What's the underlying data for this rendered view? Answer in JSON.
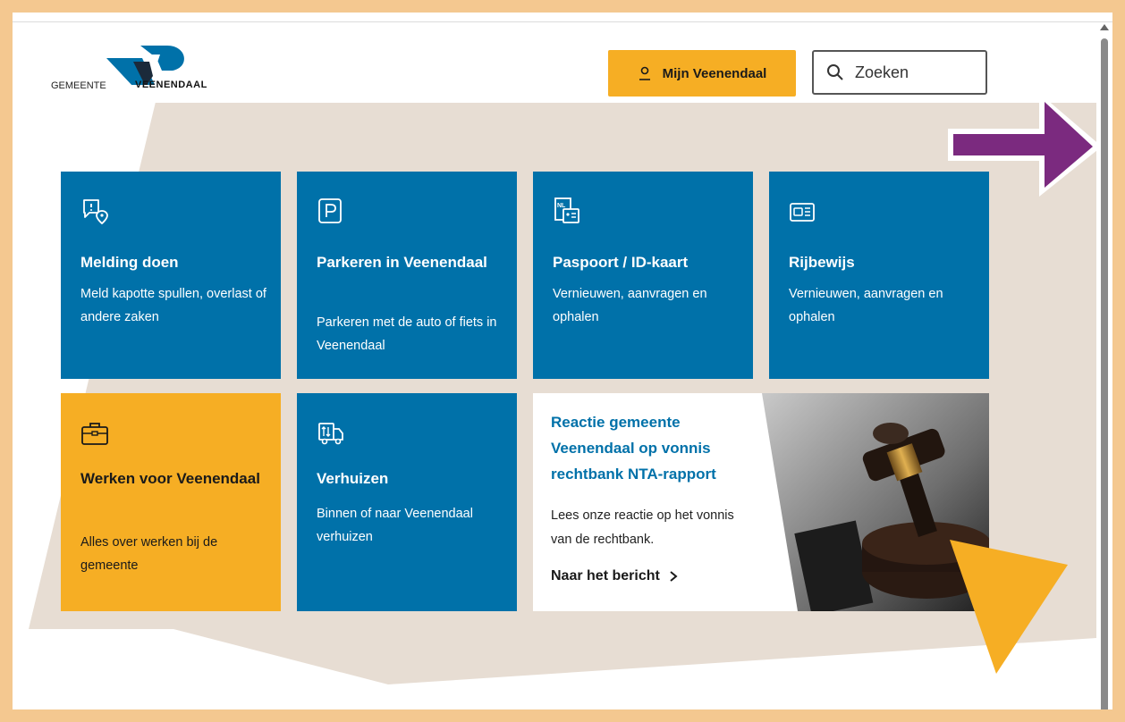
{
  "header": {
    "logo_prefix": "GEMEENTE",
    "logo_name": "VEENENDAAL",
    "account_button_label": "Mijn Veenendaal",
    "search_placeholder": "Zoeken"
  },
  "tiles": [
    {
      "title": "Melding doen",
      "description": "Meld kapotte spullen, overlast of andere zaken",
      "icon": "report-location-icon"
    },
    {
      "title": "Parkeren in Veenendaal",
      "description": "Parkeren met de auto of fiets in Veenendaal",
      "icon": "parking-icon"
    },
    {
      "title": "Paspoort / ID-kaart",
      "description": "Vernieuwen, aanvragen en ophalen",
      "icon": "passport-id-icon",
      "icon_text": "NL"
    },
    {
      "title": "Rijbewijs",
      "description": "Vernieuwen, aanvragen en ophalen",
      "icon": "driving-license-icon"
    },
    {
      "title": "Werken voor Veenendaal",
      "description": "Alles over werken bij de gemeente",
      "icon": "briefcase-icon"
    },
    {
      "title": "Verhuizen",
      "description": "Binnen of naar Veenendaal verhuizen",
      "icon": "moving-truck-icon"
    }
  ],
  "news": {
    "title": "Reactie gemeente Veenendaal op vonnis rechtbank NTA-rapport",
    "summary": "Lees onze reactie op het vonnis van de rechtbank.",
    "link_label": "Naar het bericht",
    "image": "judge-gavel-photo"
  },
  "colors": {
    "brand_blue": "#0071a9",
    "accent_yellow": "#f6ae24",
    "annotation_purple": "#7b2a7f",
    "background_beige": "#e7ddd3",
    "outer_border": "#f4c890"
  }
}
